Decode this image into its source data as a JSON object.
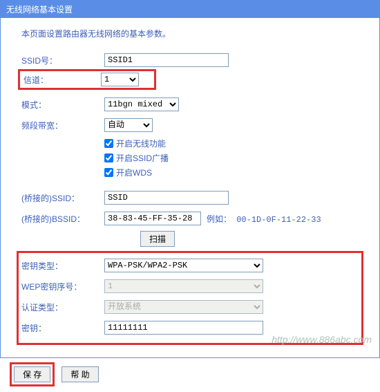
{
  "window": {
    "title": "无线网络基本设置"
  },
  "intro": "本页面设置路由器无线网络的基本参数。",
  "labels": {
    "ssid": "SSID号：",
    "channel": "信道：",
    "mode": "模式：",
    "bandwidth": "频段带宽：",
    "bridge_ssid": "(桥接的)SSID：",
    "bridge_bssid": "(桥接的)BSSID：",
    "example_prefix": "例如：",
    "key_type": "密钥类型：",
    "wep_index": "WEP密钥序号：",
    "auth_type": "认证类型：",
    "key": "密钥："
  },
  "values": {
    "ssid": "SSID1",
    "channel": "1",
    "mode": "11bgn mixed",
    "bandwidth": "自动",
    "bridge_ssid": "SSID",
    "bridge_bssid": "38-83-45-FF-35-28",
    "example_mac": "00-1D-0F-11-22-33",
    "key_type": "WPA-PSK/WPA2-PSK",
    "wep_index": "1",
    "auth_type": "开放系统",
    "key": "11111111"
  },
  "checkboxes": {
    "enable_wireless": "开启无线功能",
    "enable_ssid_broadcast": "开启SSID广播",
    "enable_wds": "开启WDS"
  },
  "buttons": {
    "scan": "扫描",
    "save": "保 存",
    "help": "帮 助"
  },
  "watermark": "http://www.886abc.com"
}
